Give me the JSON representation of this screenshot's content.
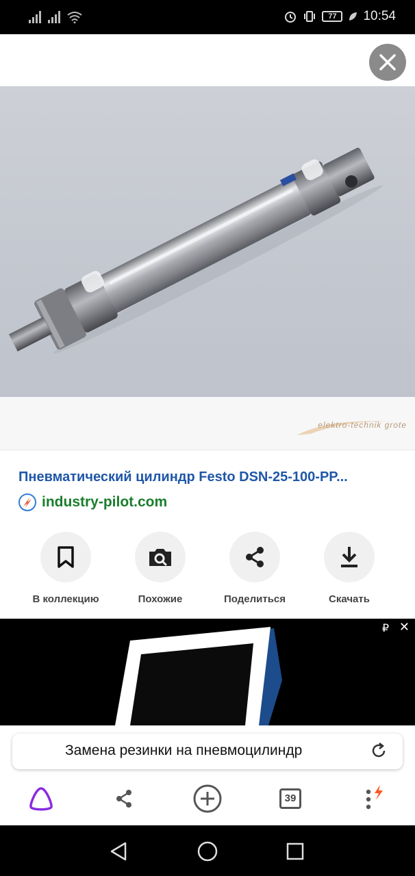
{
  "status_bar": {
    "time": "10:54",
    "battery": "77"
  },
  "viewer": {
    "watermark": "elektro-technik grote",
    "title": "Пневматический цилиндр Festo DSN-25-100-PP...",
    "source": "industry-pilot.com",
    "actions": [
      {
        "label": "В коллекцию",
        "icon": "bookmark-icon"
      },
      {
        "label": "Похожие",
        "icon": "camera-search-icon"
      },
      {
        "label": "Поделиться",
        "icon": "share-icon"
      },
      {
        "label": "Скачать",
        "icon": "download-icon"
      }
    ]
  },
  "ad": {
    "ruble": "₽",
    "close": "✕"
  },
  "search": {
    "query": "Замена резинки на пневмоцилиндр"
  },
  "toolbar": {
    "tabs_count": "39",
    "accent_color": "#8a2be2",
    "notify_color": "#ff5722"
  }
}
